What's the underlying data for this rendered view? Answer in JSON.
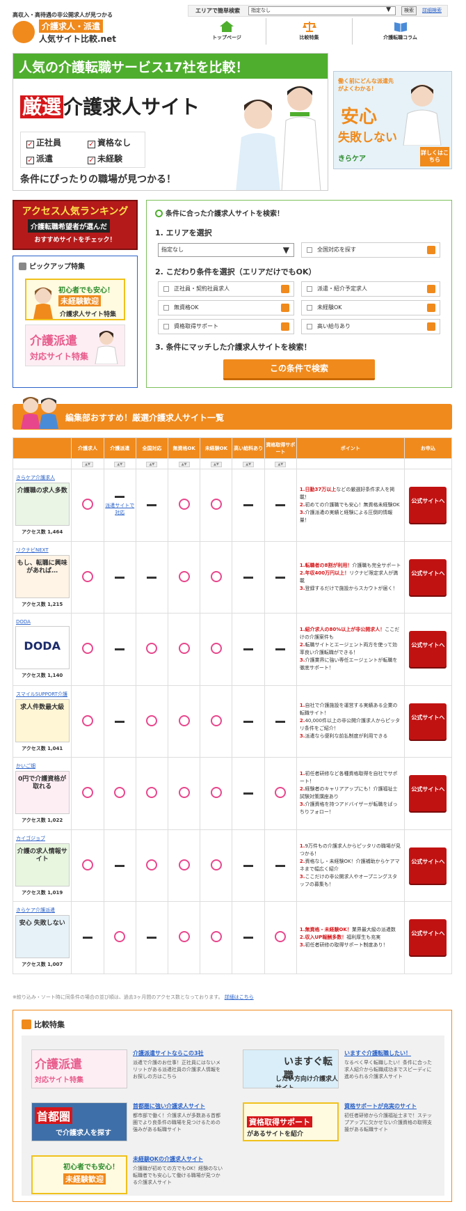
{
  "header": {
    "tagline": "高収入・高待遇の非公開求人が見つかる",
    "logo_line1": "介護求人・派遣",
    "logo_line2": "人気サイト比較.net",
    "search_label": "エリアで簡単検索",
    "search_select": "指定なし",
    "search_button": "検索",
    "search_link": "詳細検索",
    "nav": [
      "トップページ",
      "比較特集",
      "介護転職コラム"
    ]
  },
  "hero": {
    "top_text": "人気の介護転職サービス17社を比較！",
    "title_highlight": "厳選",
    "title_rest": "介護求人サイト",
    "checks": [
      "正社員",
      "資格なし",
      "派遣",
      "未経験"
    ],
    "sub": "条件にぴったりの職場が見つかる！"
  },
  "side_ad": {
    "t1": "働く前にどんな派遣先がよくわかる！",
    "t2": "安心",
    "t3": "失敗しない",
    "brand": "きらケア",
    "button": "詳しくはこちら"
  },
  "rank_banner": {
    "line1": "アクセス人気ランキング",
    "line2": "介護転職希望者が選んだ",
    "line3": "おすすめサイトをチェック！"
  },
  "pickup": {
    "heading": "ピックアップ特集",
    "b1_t1": "初心者でも安心！",
    "b1_t2": "未経験歓迎",
    "b1_t3": "介護求人サイト特集",
    "b2_t1": "介護派遣",
    "b2_t2": "対応サイト特集"
  },
  "search": {
    "heading": "条件に合った介護求人サイトを検索！",
    "step1": "1. エリアを選択",
    "area_select": "指定なし",
    "nationwide": "全国対応を探す",
    "step2": "2. こだわり条件を選択（エリアだけでもOK）",
    "conditions": [
      "正社員・契約社員求人",
      "派遣・紹介予定求人",
      "無資格OK",
      "未経験OK",
      "資格取得サポート",
      "高い給与あり"
    ],
    "step3": "3. 条件にマッチした介護求人サイトを検索！",
    "button": "この条件で検索"
  },
  "section_title": "編集部おすすめ！厳選介護求人サイト一覧",
  "table": {
    "headers": [
      "",
      "介護求人",
      "介護派遣",
      "全国対応",
      "無資格OK",
      "未経験OK",
      "高い給料あり",
      "資格取得サポート",
      "ポイント",
      "お申込"
    ],
    "sort_label": "▲▼",
    "dispatch_link": "派遣サイトで対応",
    "apply_label": "公式サイトへ",
    "access_prefix": "アクセス数",
    "rows": [
      {
        "name": "きらケア介護求人",
        "thumb": "介護職の求人多数",
        "access": "1,464",
        "cells": [
          "o",
          "link",
          "-",
          "o",
          "o",
          "-",
          "-"
        ],
        "p1b": "1.日勤37万以上",
        "p1": "などの厳選好条件求人を掲載！",
        "p2b": "2.",
        "p2": "初めての介護職でも安心！無資格未経験OK",
        "p3b": "3.",
        "p3": "介護派遣の実績と経験による圧倒的情報量！"
      },
      {
        "name": "リクナビNEXT",
        "thumb": "もし、転職に興味があれば…",
        "access": "1,215",
        "cells": [
          "o",
          "-",
          "-",
          "o",
          "o",
          "-",
          "-"
        ],
        "p1b": "1.転職者の8割が利用！",
        "p1": "介護職も完全サポート",
        "p2b": "2.年収400万円以上！",
        "p2": "リクナビ限定求人が満載",
        "p3b": "3.",
        "p3": "登録するだけで施設からスカウトが届く！"
      },
      {
        "name": "DODA",
        "thumb": "DODA",
        "access": "1,140",
        "cells": [
          "o",
          "-",
          "o",
          "o",
          "o",
          "-",
          "-"
        ],
        "p1b": "1.紹介求人の80%以上が非公開求人！",
        "p1": "ここだけの介護案件も",
        "p2b": "2.",
        "p2": "転職サイトとエージェント両方を使って効率良い介護転職ができる！",
        "p3b": "3.",
        "p3": "介護業界に強い専任エージェントが転職を徹底サポート！"
      },
      {
        "name": "スマイルSUPPORT介護",
        "thumb": "求人件数最大級",
        "access": "1,041",
        "cells": [
          "o",
          "-",
          "o",
          "o",
          "o",
          "-",
          "-"
        ],
        "p1b": "1.",
        "p1": "自社で介護施設を運営する実績ある企業の転職サイト！",
        "p2b": "2.",
        "p2": "40,000件以上の非公開介護求人からピッタリ条件をご紹介！",
        "p3b": "3.",
        "p3": "派遣なら便利な前払制度が利用できる"
      },
      {
        "name": "かいご畑",
        "thumb": "0円で介護資格が取れる",
        "access": "1,022",
        "cells": [
          "o",
          "o",
          "o",
          "o",
          "o",
          "-",
          "o"
        ],
        "p1b": "1.",
        "p1": "初任者研修など各種資格取得を自社でサポート！",
        "p2b": "2.",
        "p2": "経験者のキャリアアップにも！介護福祉士試験対策講座あり",
        "p3b": "3.",
        "p3": "介護資格を持つアドバイザーが転職をばっちりフォロー！"
      },
      {
        "name": "カイゴジョブ",
        "thumb": "介護の求人情報サイト",
        "access": "1,019",
        "cells": [
          "o",
          "-",
          "o",
          "o",
          "o",
          "-",
          "-"
        ],
        "p1b": "1.",
        "p1": "9万件もの介護求人からピッタリの職場が見つかる！",
        "p2b": "2.",
        "p2": "資格なし・未経験OK！介護補助からケアマネまで幅広く紹介",
        "p3b": "3.",
        "p3": "ここだけの非公開求人やオープニングスタッフの募集も！"
      },
      {
        "name": "きらケア介護派遣",
        "thumb": "安心 失敗しない",
        "access": "1,007",
        "cells": [
          "-",
          "o",
          "-",
          "o",
          "o",
          "-",
          "o"
        ],
        "p1b": "1.無資格・未経験OK！",
        "p1": "業界最大級の派遣数",
        "p2b": "2.収入UP報酬多数！",
        "p2": "福利厚生も充実",
        "p3b": "3.",
        "p3": "初任者研修の取得サポート制度あり！"
      }
    ]
  },
  "note": "※絞り込み・ソート時に同条件の場合の並び順は、過去3ヶ月間のアクセス数となっております。",
  "note_link": "詳細はこちら",
  "feature": {
    "heading": "比較特集",
    "items": [
      {
        "thumb1": "介護派遣",
        "thumb2": "対応サイト特集",
        "title": "介護派遣サイトならこの3社",
        "desc": "派遣で介護のお仕事！正社員にはないメリットがある派遣社員の介護求人情報をお探しの方はこちら"
      },
      {
        "thumb1": "いますぐ転職",
        "thumb2": "したい方向け介護求人サイト",
        "title": "いますぐ介護転職したい！",
        "desc": "なるべく早く転職したい！条件に合った求人紹介から転職成功までスピーディに進められる介護求人サイト"
      },
      {
        "thumb1": "首都圏",
        "thumb2": "で介護求人を探す",
        "title": "首都圏に強い介護求人サイト",
        "desc": "都市部で働く！介護求人が多数ある首都圏でより良条件の職場を見つけるための強みがある転職サイト"
      },
      {
        "thumb1": "資格取得サポート",
        "thumb2": "があるサイトを紹介",
        "title": "資格サポートが充実のサイト",
        "desc": "初任者研修から介護福祉士まで！ステップアップに欠かせない介護資格の取得支援がある転職サイト"
      },
      {
        "thumb1": "初心者でも安心！",
        "thumb2": "未経験歓迎",
        "title": "未経験OKの介護求人サイト",
        "desc": "介護職が初めての方でもOK！経験のない転職者でも安心して働ける職場が見つかる介護求人サイト"
      }
    ]
  },
  "colors": {
    "orange": "#f08a1c",
    "green": "#4fae2e",
    "red": "#d6171b",
    "pink": "#e8468c",
    "blue": "#2a62c9"
  }
}
